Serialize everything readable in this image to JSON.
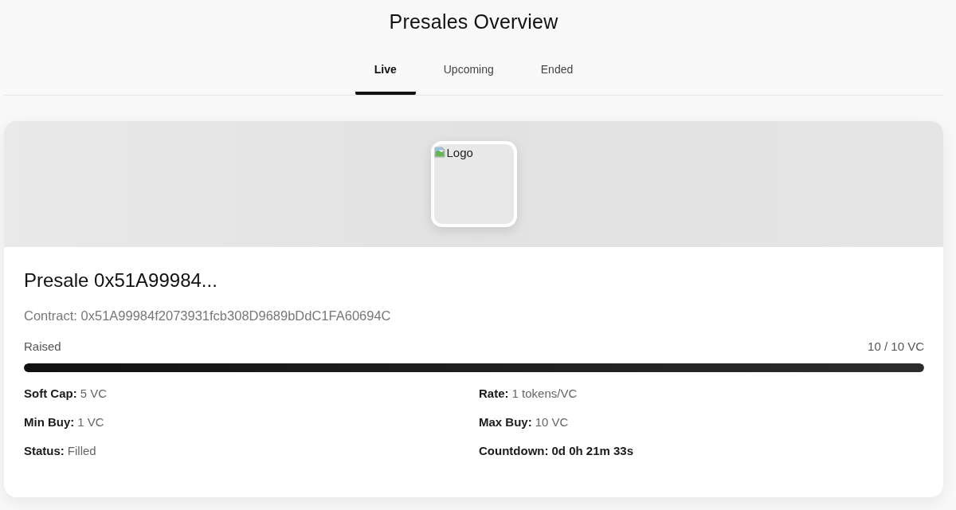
{
  "page": {
    "title": "Presales Overview"
  },
  "tabs": [
    {
      "label": "Live",
      "selected": true
    },
    {
      "label": "Upcoming",
      "selected": false
    },
    {
      "label": "Ended",
      "selected": false
    }
  ],
  "presales": [
    {
      "logo": {
        "alt": "Logo"
      },
      "title": "Presale 0x51A99984...",
      "contract": "Contract: 0x51A99984f2073931fcb308D9689bDdC1FA60694C",
      "raised": {
        "label": "Raised",
        "reading": "10 / 10 VC",
        "level": 1
      },
      "details": [
        {
          "kind": "stat",
          "label": "Soft Cap:",
          "value": "5 VC"
        },
        {
          "kind": "stat",
          "label": "Rate:",
          "value": "1 tokens/VC"
        },
        {
          "kind": "stat",
          "label": "Min Buy:",
          "value": "1 VC"
        },
        {
          "kind": "stat",
          "label": "Max Buy:",
          "value": "10 VC"
        },
        {
          "kind": "stat",
          "label": "Status:",
          "value": "Filled"
        },
        {
          "kind": "countdown",
          "label": "Countdown:",
          "value": "0d 0h 21m 33s"
        }
      ]
    }
  ]
}
